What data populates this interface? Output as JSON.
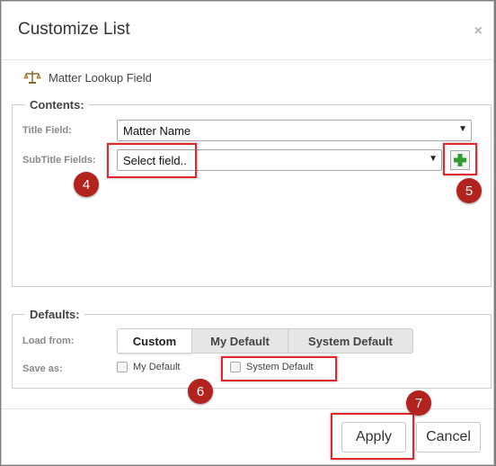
{
  "dialog": {
    "title": "Customize List",
    "close_glyph": "×",
    "subtitle": "Matter Lookup Field",
    "subtitle_icon": "scales-icon"
  },
  "contents": {
    "legend": "Contents:",
    "title_field_label": "Title Field:",
    "title_field_value": "Matter Name",
    "subtitle_fields_label": "SubTitle Fields:",
    "subtitle_fields_value": "Select field..",
    "add_icon": "plus-icon"
  },
  "defaults": {
    "legend": "Defaults:",
    "load_from_label": "Load from:",
    "load_options": [
      "Custom",
      "My Default",
      "System Default"
    ],
    "load_selected": "Custom",
    "save_as_label": "Save as:",
    "save_options": [
      {
        "label": "My Default",
        "checked": false
      },
      {
        "label": "System Default",
        "checked": false
      }
    ]
  },
  "footer": {
    "apply_label": "Apply",
    "cancel_label": "Cancel"
  },
  "annotations": [
    "4",
    "5",
    "6",
    "7"
  ],
  "colors": {
    "highlight": "#e0282c",
    "badge": "#b2231f",
    "plus": "#2e9b2e"
  }
}
